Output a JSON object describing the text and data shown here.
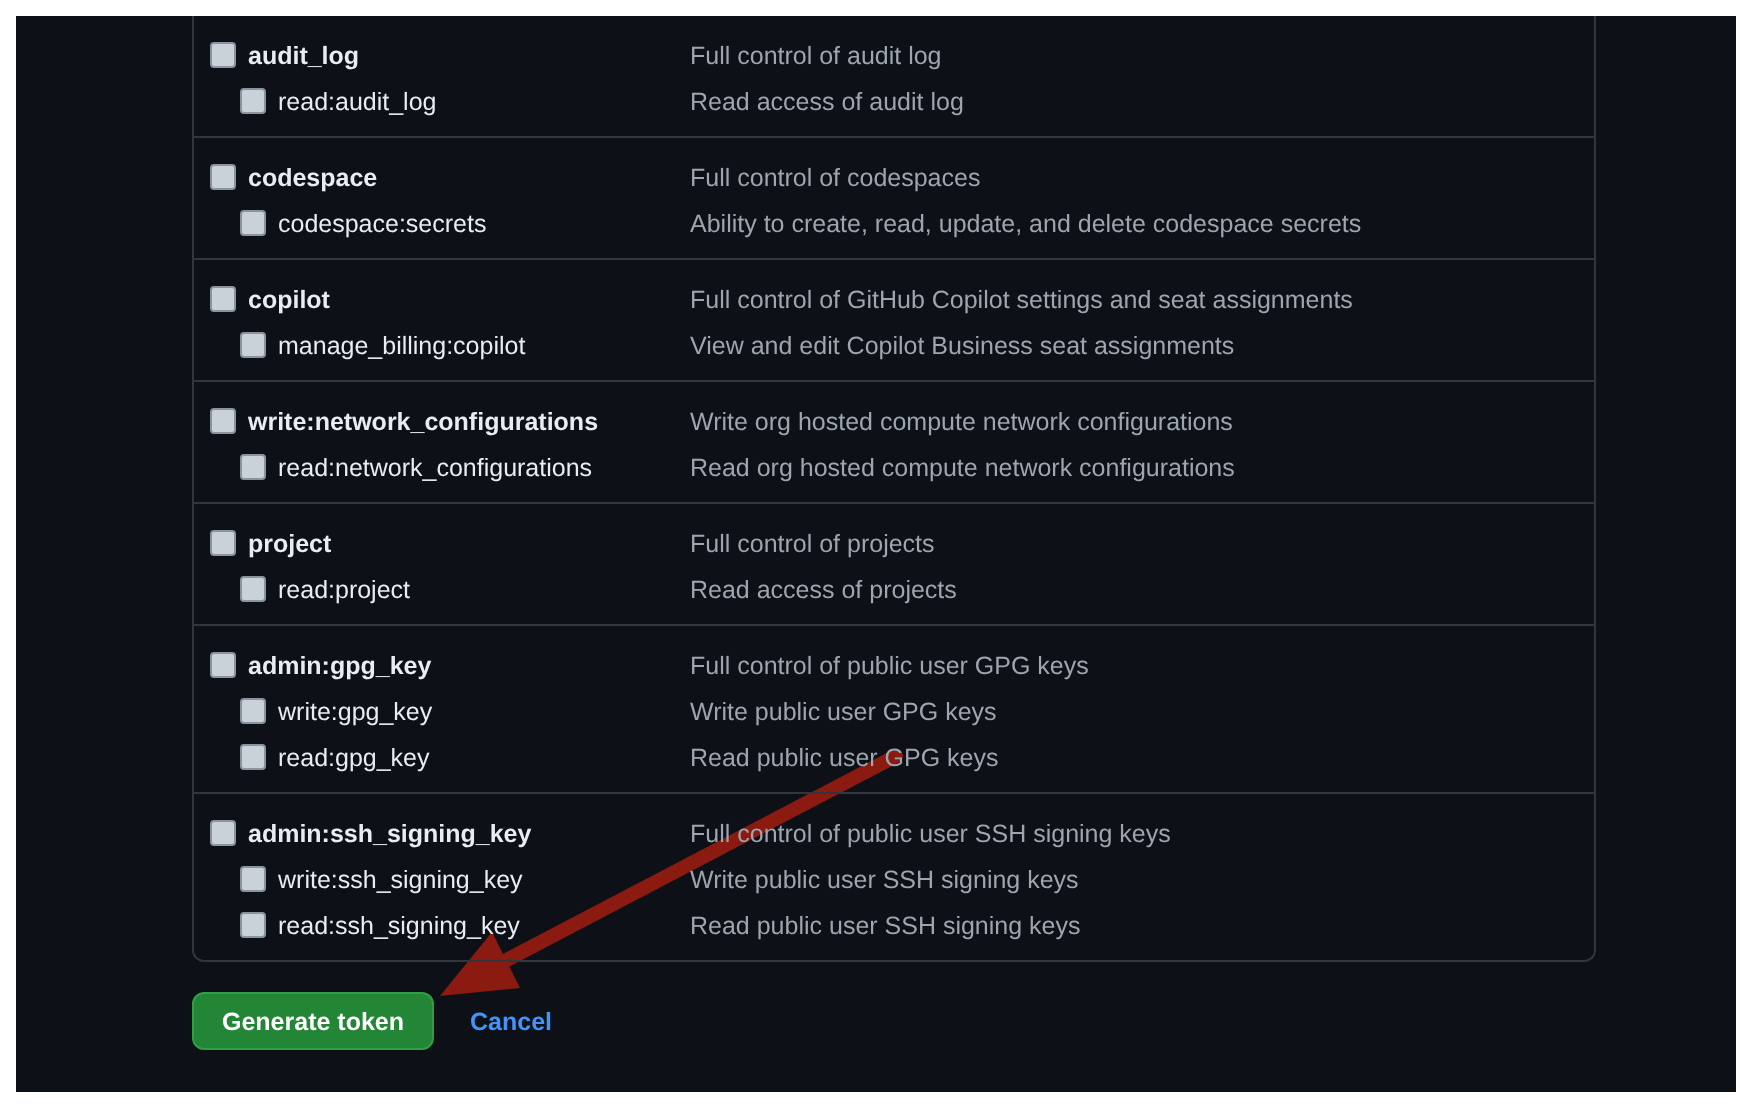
{
  "scope_groups": [
    {
      "scopes": [
        {
          "name": "audit_log",
          "description": "Full control of audit log",
          "checked": false
        },
        {
          "name": "read:audit_log",
          "description": "Read access of audit log",
          "checked": false
        }
      ]
    },
    {
      "scopes": [
        {
          "name": "codespace",
          "description": "Full control of codespaces",
          "checked": false
        },
        {
          "name": "codespace:secrets",
          "description": "Ability to create, read, update, and delete codespace secrets",
          "checked": false
        }
      ]
    },
    {
      "scopes": [
        {
          "name": "copilot",
          "description": "Full control of GitHub Copilot settings and seat assignments",
          "checked": false
        },
        {
          "name": "manage_billing:copilot",
          "description": "View and edit Copilot Business seat assignments",
          "checked": false
        }
      ]
    },
    {
      "scopes": [
        {
          "name": "write:network_configurations",
          "description": "Write org hosted compute network configurations",
          "checked": false
        },
        {
          "name": "read:network_configurations",
          "description": "Read org hosted compute network configurations",
          "checked": false
        }
      ]
    },
    {
      "scopes": [
        {
          "name": "project",
          "description": "Full control of projects",
          "checked": false
        },
        {
          "name": "read:project",
          "description": "Read access of projects",
          "checked": false
        }
      ]
    },
    {
      "scopes": [
        {
          "name": "admin:gpg_key",
          "description": "Full control of public user GPG keys",
          "checked": false
        },
        {
          "name": "write:gpg_key",
          "description": "Write public user GPG keys",
          "checked": false
        },
        {
          "name": "read:gpg_key",
          "description": "Read public user GPG keys",
          "checked": false
        }
      ]
    },
    {
      "scopes": [
        {
          "name": "admin:ssh_signing_key",
          "description": "Full control of public user SSH signing keys",
          "checked": false
        },
        {
          "name": "write:ssh_signing_key",
          "description": "Write public user SSH signing keys",
          "checked": false
        },
        {
          "name": "read:ssh_signing_key",
          "description": "Read public user SSH signing keys",
          "checked": false
        }
      ]
    }
  ],
  "generate_button": "Generate token",
  "cancel_link": "Cancel"
}
